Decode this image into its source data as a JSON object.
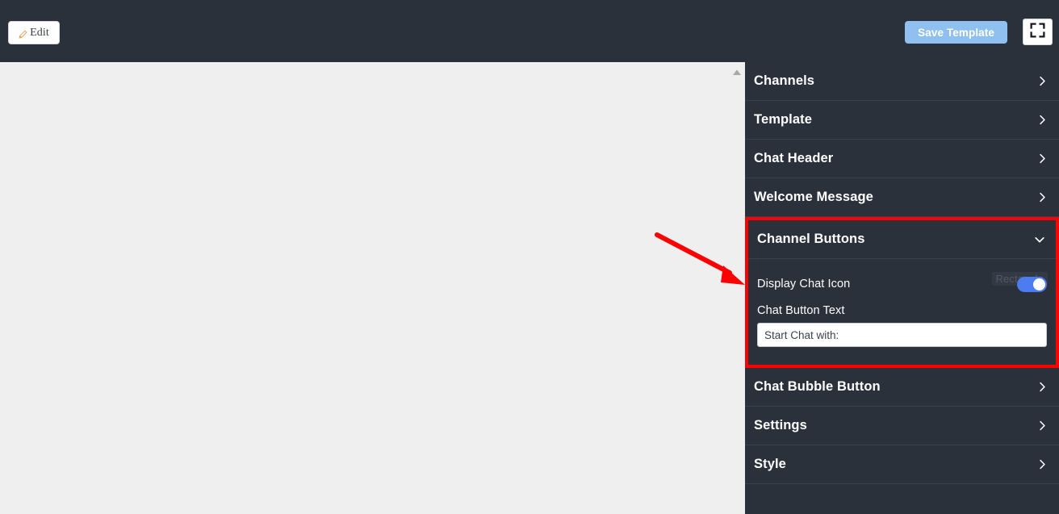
{
  "toolbar": {
    "edit_label": "Edit",
    "edit_icon": "pencil-icon",
    "save_template_label": "Save Template",
    "fullscreen_icon": "fullscreen-icon",
    "accent_purple": "#6c4fd6",
    "accent_red": "#ee1b24",
    "save_button_color": "#8fc0f0"
  },
  "preview": {
    "background": "#efeff0",
    "scroll_up_icon": "scroll-up-arrow-icon"
  },
  "panel": {
    "background": "#2b313b",
    "sections": [
      {
        "label": "Channels",
        "state": "collapsed",
        "icon": "chevron-right-icon"
      },
      {
        "label": "Template",
        "state": "collapsed",
        "icon": "chevron-right-icon"
      },
      {
        "label": "Chat Header",
        "state": "collapsed",
        "icon": "chevron-right-icon"
      },
      {
        "label": "Welcome Message",
        "state": "collapsed",
        "icon": "chevron-right-icon"
      },
      {
        "label": "Channel Buttons",
        "state": "expanded",
        "icon": "chevron-down-icon"
      },
      {
        "label": "Chat Bubble Button",
        "state": "collapsed",
        "icon": "chevron-right-icon"
      },
      {
        "label": "Settings",
        "state": "collapsed",
        "icon": "chevron-right-icon"
      },
      {
        "label": "Style",
        "state": "collapsed",
        "icon": "chevron-right-icon"
      }
    ],
    "channel_buttons": {
      "title": "Channel Buttons",
      "tooltip": "Rectangle",
      "display_chat_icon_label": "Display Chat Icon",
      "display_chat_icon_state": "on",
      "toggle_color": "#4d7cf0",
      "chat_button_text_label": "Chat Button Text",
      "chat_button_text_value": "Start Chat with:"
    }
  },
  "annotation": {
    "arrow_color": "#ff0000",
    "highlight_color": "#ff0000"
  }
}
